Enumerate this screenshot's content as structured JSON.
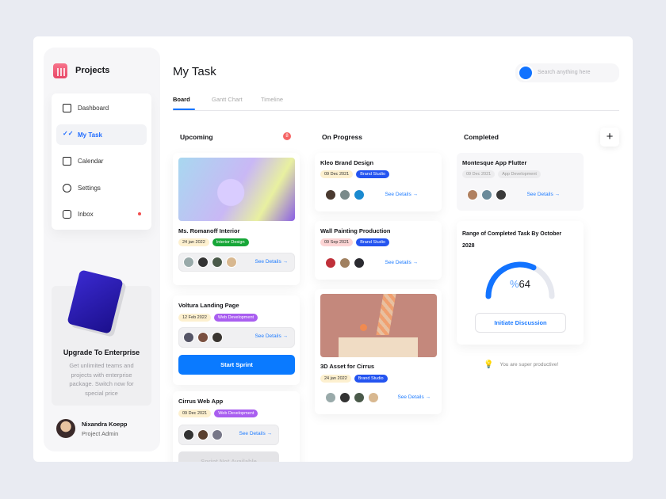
{
  "sidebar": {
    "brand": "Projects",
    "items": [
      {
        "label": "Dashboard",
        "icon": "clipboard-icon"
      },
      {
        "label": "My Task",
        "icon": "double-check-icon"
      },
      {
        "label": "Calendar",
        "icon": "calendar-icon"
      },
      {
        "label": "Settings",
        "icon": "gear-icon"
      },
      {
        "label": "Inbox",
        "icon": "inbox-icon"
      }
    ],
    "upgrade": {
      "title": "Upgrade To Enterprise",
      "text": "Get unlimited teams and projects with enterprise package. Switch now for special price"
    },
    "user": {
      "name": "Nixandra Koepp",
      "role": "Project Admin"
    }
  },
  "header": {
    "title": "My Task",
    "search_placeholder": "Search anything here"
  },
  "tabs": [
    "Board",
    "Gantt Chart",
    "Timeline"
  ],
  "columns": {
    "upcoming": {
      "title": "Upcoming",
      "count": "8"
    },
    "progress": {
      "title": "On Progress"
    },
    "completed": {
      "title": "Completed"
    }
  },
  "cards": {
    "romanoff": {
      "title": "Ms. Romanoff Interior",
      "date": "24 jan 2022",
      "tag": "Interior Design"
    },
    "voltura": {
      "title": "Voltura Landing Page",
      "date": "12 Feb 2022",
      "tag": "Web Development",
      "button": "Start Sprint"
    },
    "cirrusweb": {
      "title": "Cirrus Web App",
      "date": "09 Dec 2021",
      "tag": "Web Development",
      "button": "Sprint Not Available"
    },
    "kleo": {
      "title": "Kleo Brand Design",
      "date": "09 Dec 2021",
      "tag": "Brand Studio"
    },
    "wall": {
      "title": "Wall Painting Production",
      "date": "09 Sep 2021",
      "tag": "Brand Studio"
    },
    "asset": {
      "title": "3D Asset for Cirrus",
      "date": "24 jan 2022",
      "tag": "Brand Studio"
    },
    "montesque": {
      "title": "Montesque App Flutter",
      "date": "09 Dec 2021",
      "tag": "App Development"
    }
  },
  "see_details": "See Details →",
  "gauge": {
    "title": "Range of Completed Task By October 2028",
    "percent_sign": "%",
    "value": 64,
    "value_label": "64",
    "button": "Initiate Discussion"
  },
  "tip": "You are super productive!",
  "colors": {
    "accent": "#1273ff",
    "green": "#16a637",
    "purple": "#a95ef0",
    "blue": "#2454f0",
    "red": "#f56565"
  }
}
